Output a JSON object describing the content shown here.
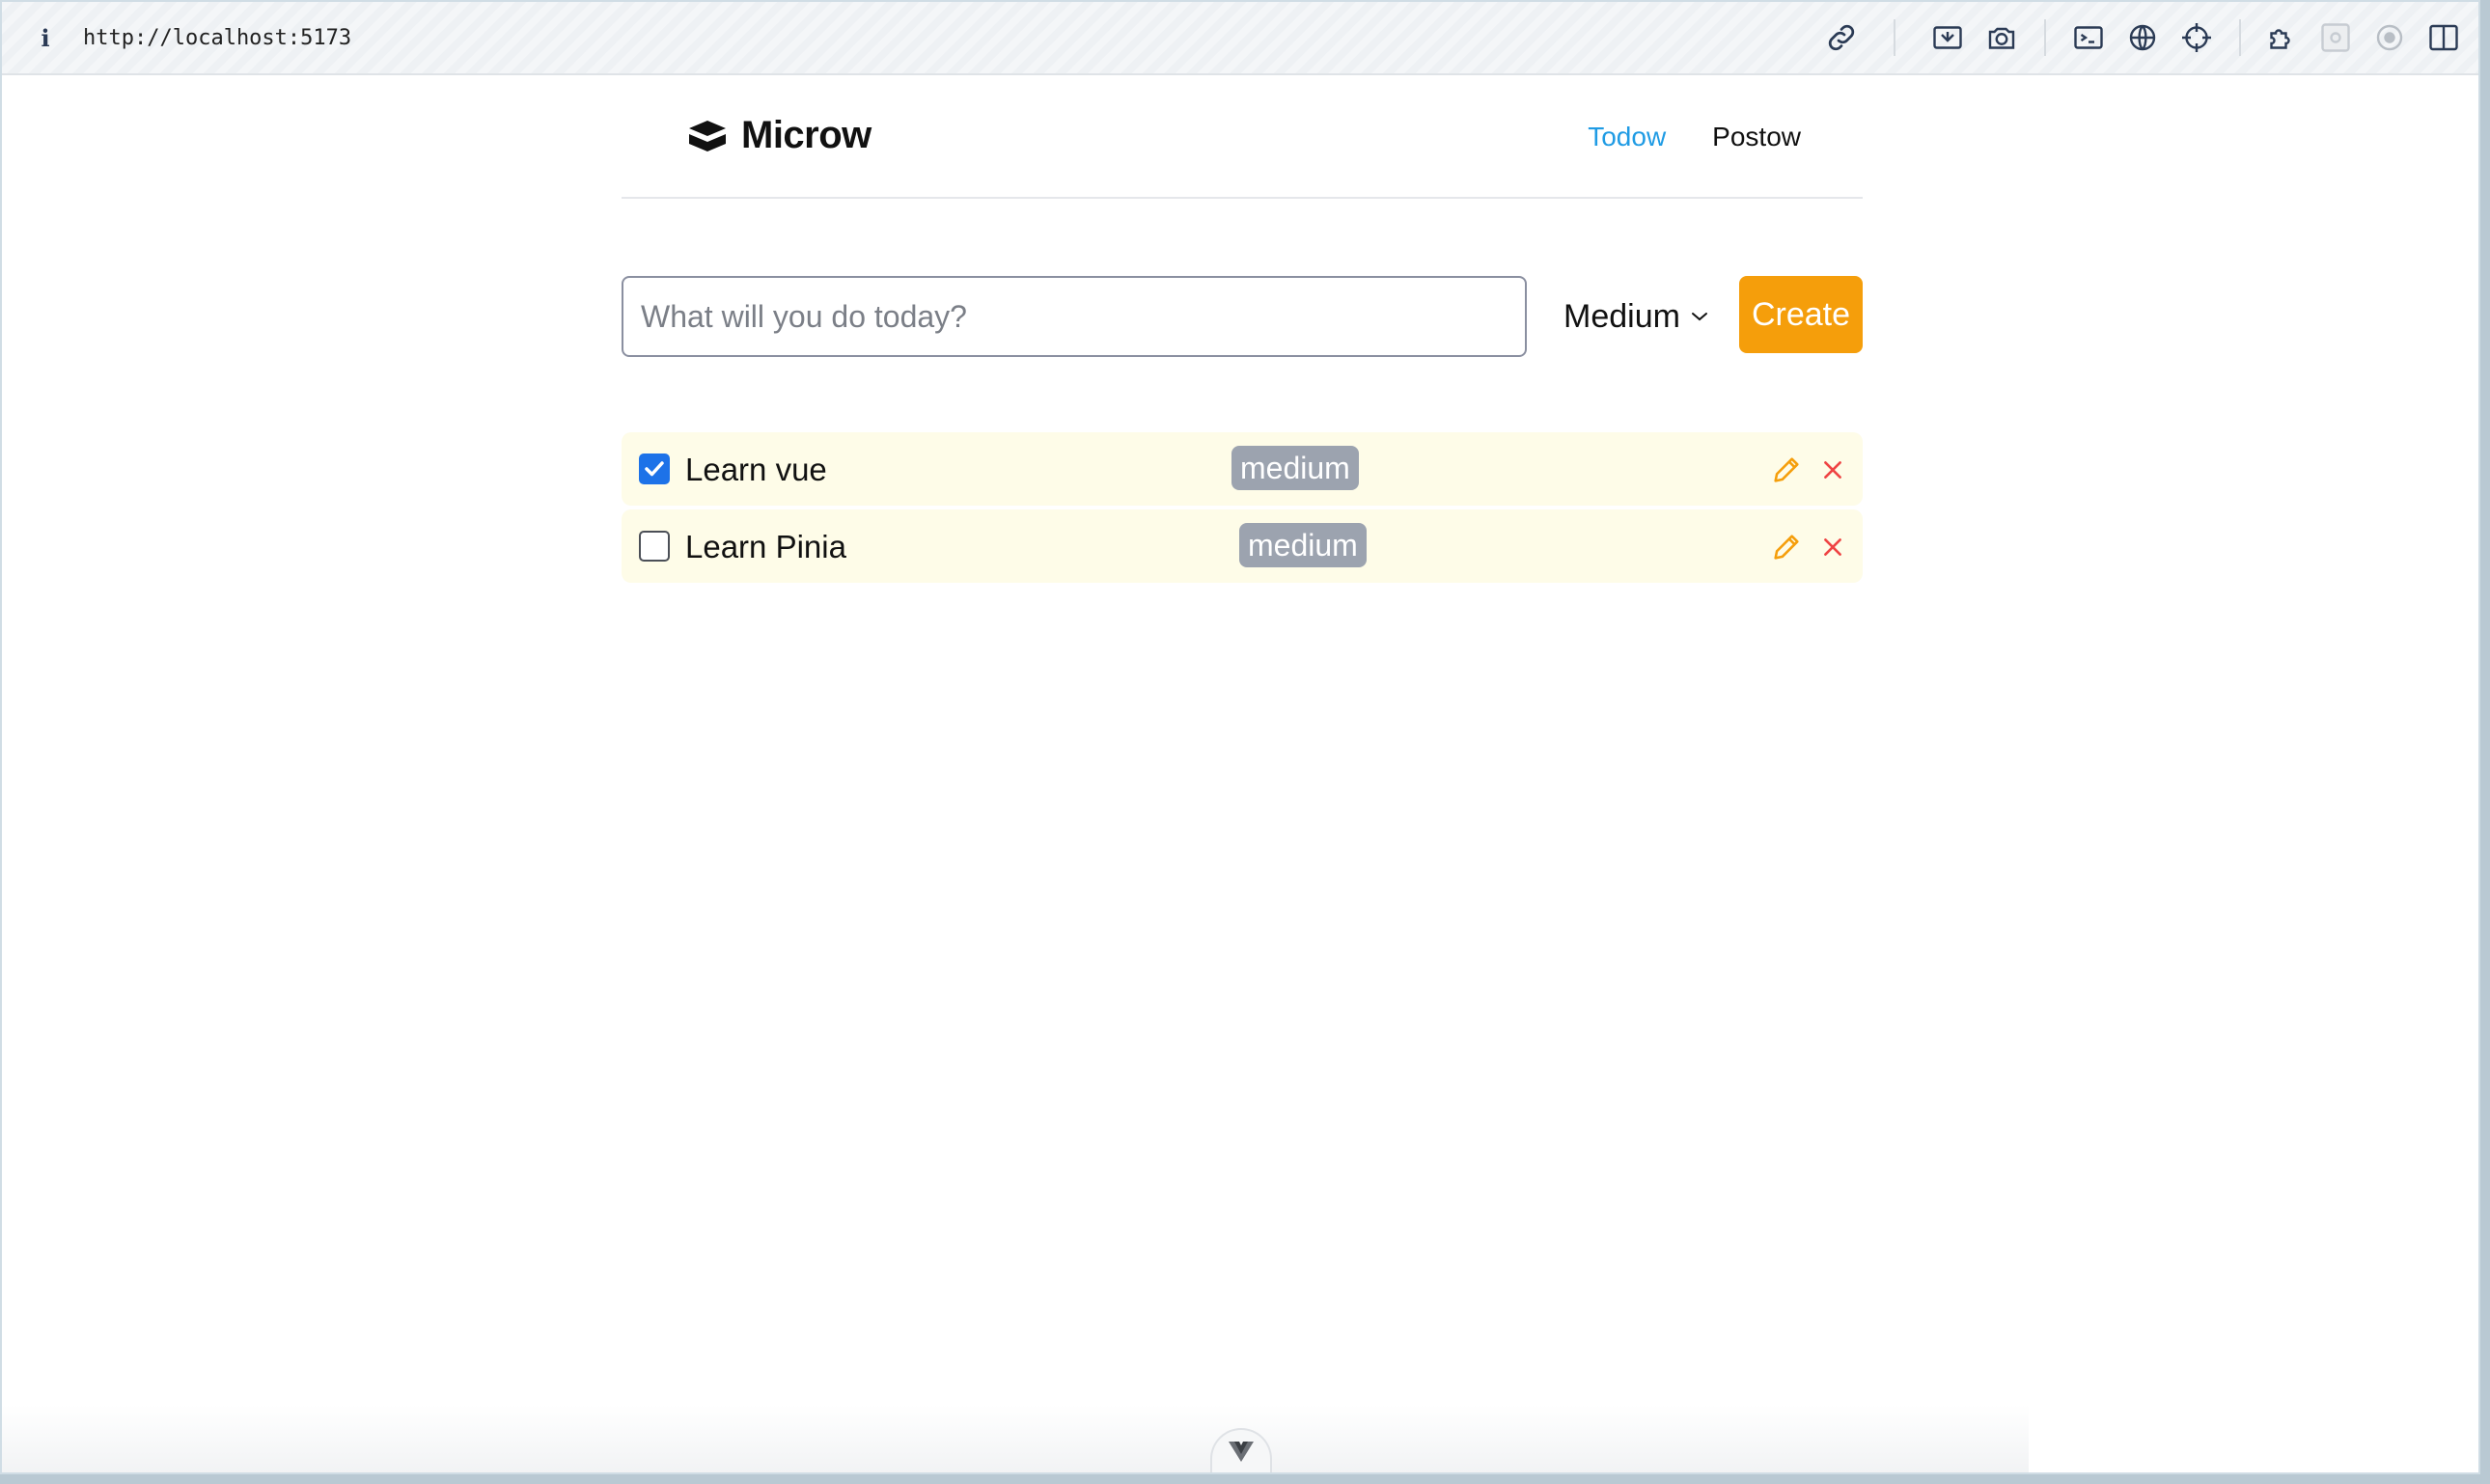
{
  "browser": {
    "info_icon": "i",
    "url": "http://localhost:5173",
    "toolbar_icons": [
      "link-icon",
      "inspect-component-icon",
      "screenshot-icon",
      "terminal-icon",
      "globe-icon",
      "crosshair-icon",
      "extensions-icon",
      "devtools-icon",
      "capture-icon",
      "split-view-icon"
    ]
  },
  "header": {
    "logo_text": "Microw",
    "nav": [
      {
        "label": "Todow",
        "active": true
      },
      {
        "label": "Postow",
        "active": false
      }
    ]
  },
  "create_form": {
    "placeholder": "What will you do today?",
    "value": "",
    "priority": "Medium",
    "create_label": "Create"
  },
  "todos": [
    {
      "title": "Learn vue",
      "done": true,
      "priority": "medium"
    },
    {
      "title": "Learn Pinia",
      "done": false,
      "priority": "medium"
    }
  ],
  "colors": {
    "accent": "#f59e0b",
    "nav_active": "#1f9be4",
    "row_bg": "#fefce8",
    "badge_bg": "#9ca3af",
    "delete": "#ef4444",
    "checkbox": "#1d72e8"
  }
}
